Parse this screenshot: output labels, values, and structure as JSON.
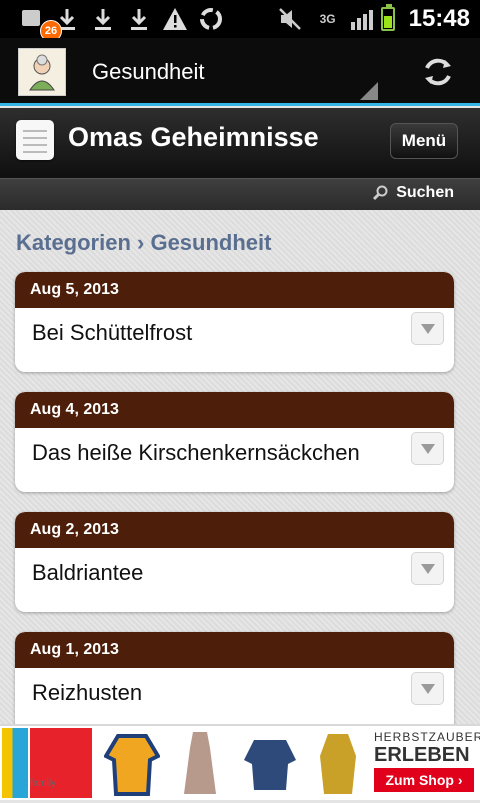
{
  "status_bar": {
    "notification_count": "26",
    "network": "3G",
    "time": "15:48",
    "icons": [
      "notification-icon",
      "download-icon",
      "download-icon",
      "download-icon",
      "warning-icon",
      "recycle-icon",
      "mute-icon",
      "signal-icon",
      "battery-icon"
    ]
  },
  "action_bar": {
    "title": "Gesundheit",
    "accent_color": "#33b5e5"
  },
  "site_header": {
    "title": "Omas Geheimnisse",
    "menu_label": "Menü",
    "search_label": "Suchen"
  },
  "breadcrumb": "Kategorien › Gesundheit",
  "posts": [
    {
      "date": "Aug 5, 2013",
      "title": "Bei Schüttelfrost"
    },
    {
      "date": "Aug 4, 2013",
      "title": "Das heiße Kirschenkernsäckchen"
    },
    {
      "date": "Aug 2, 2013",
      "title": "Baldriantee"
    },
    {
      "date": "Aug 1, 2013",
      "title": "Reizhusten"
    }
  ],
  "ad": {
    "brand": "family",
    "headline_top": "HERBSTZAUBER",
    "headline": "ERLEBEN",
    "button": "Zum Shop ›"
  },
  "colors": {
    "card_header": "#4d1f0a",
    "crumb": "#5a6f90",
    "ad_button": "#e0001b"
  }
}
